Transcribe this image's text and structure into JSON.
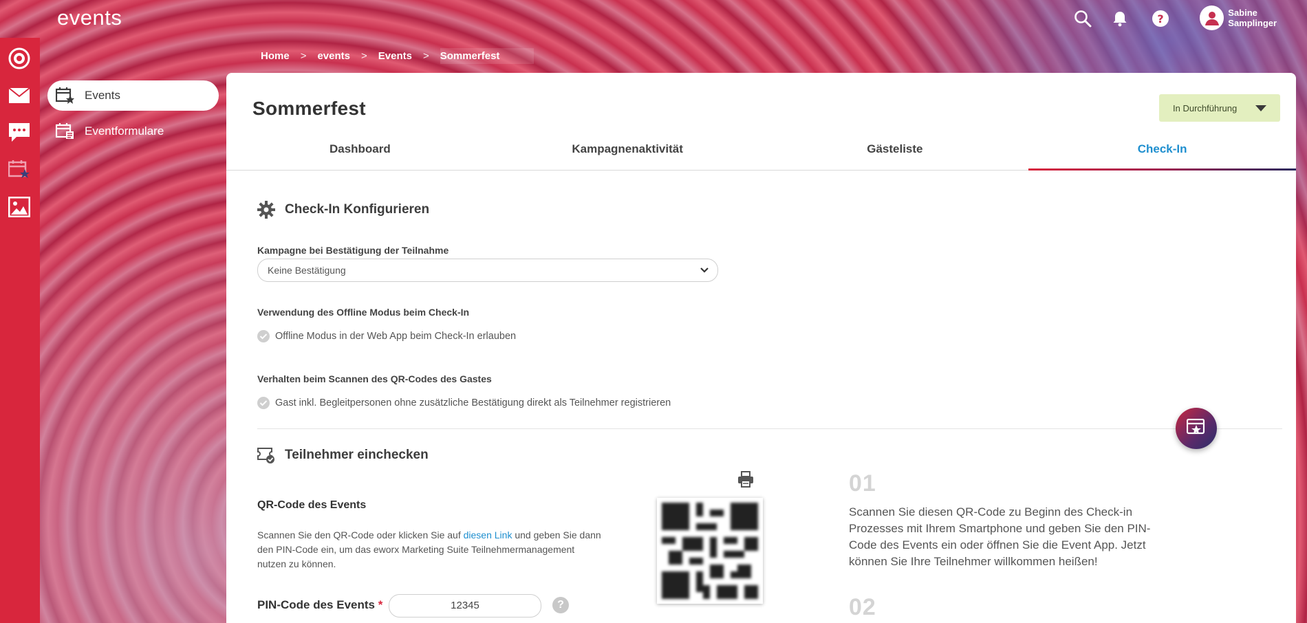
{
  "app": {
    "title": "events"
  },
  "user": {
    "name": "Sabine Samplinger"
  },
  "topbar_icons": [
    "search-icon",
    "bell-icon",
    "help-icon",
    "user-icon"
  ],
  "rail_icons": [
    "target-icon",
    "mail-icon",
    "chat-icon",
    "event-calendar-icon",
    "image-icon"
  ],
  "nav": {
    "items": [
      {
        "label": "Events",
        "icon": "event-calendar-icon",
        "active": true
      },
      {
        "label": "Eventformulare",
        "icon": "event-form-icon",
        "active": false
      }
    ]
  },
  "breadcrumb": [
    "Home",
    "events",
    "Events",
    "Sommerfest"
  ],
  "page": {
    "title": "Sommerfest"
  },
  "status": {
    "value": "In Durchführung",
    "color": "#e3efbf"
  },
  "tabs": [
    {
      "label": "Dashboard",
      "active": false
    },
    {
      "label": "Kampagnenaktivität",
      "active": false
    },
    {
      "label": "Gästeliste",
      "active": false
    },
    {
      "label": "Check-In",
      "active": true
    }
  ],
  "config": {
    "heading": "Check-In Konfigurieren",
    "campaign_label": "Kampagne bei Bestätigung der Teilnahme",
    "campaign_value": "Keine Bestätigung",
    "offline_label": "Verwendung des Offline Modus beim Check-In",
    "offline_option": "Offline Modus in der Web App beim Check-In erlauben",
    "scan_label": "Verhalten beim Scannen des QR-Codes des Gastes",
    "scan_option": "Gast inkl. Begleitpersonen ohne zusätzliche Bestätigung direkt als Teilnehmer registrieren"
  },
  "checkin": {
    "heading": "Teilnehmer einchecken",
    "qr_title": "QR-Code des Events",
    "qr_desc_before": "Scannen Sie den QR-Code oder klicken Sie auf ",
    "qr_desc_link": "diesen Link",
    "qr_desc_after": " und geben Sie dann den PIN-Code ein, um das eworx Marketing Suite Teilnehmermanagement nutzen zu können.",
    "pin_label": "PIN-Code des Events",
    "pin_required": "*",
    "pin_value": "12345",
    "help": "?"
  },
  "steps": [
    {
      "number": "01",
      "text": "Scannen Sie diesen QR-Code zu Beginn des Check-in Prozesses mit Ihrem Smartphone und geben Sie den PIN-Code des Events ein oder öffnen Sie die Event App. Jetzt können Sie Ihre Teilnehmer willkommen heißen!"
    },
    {
      "number": "02",
      "text": ""
    }
  ],
  "colors": {
    "brand_red": "#d8263d",
    "accent_blue": "#1f8fcf"
  }
}
